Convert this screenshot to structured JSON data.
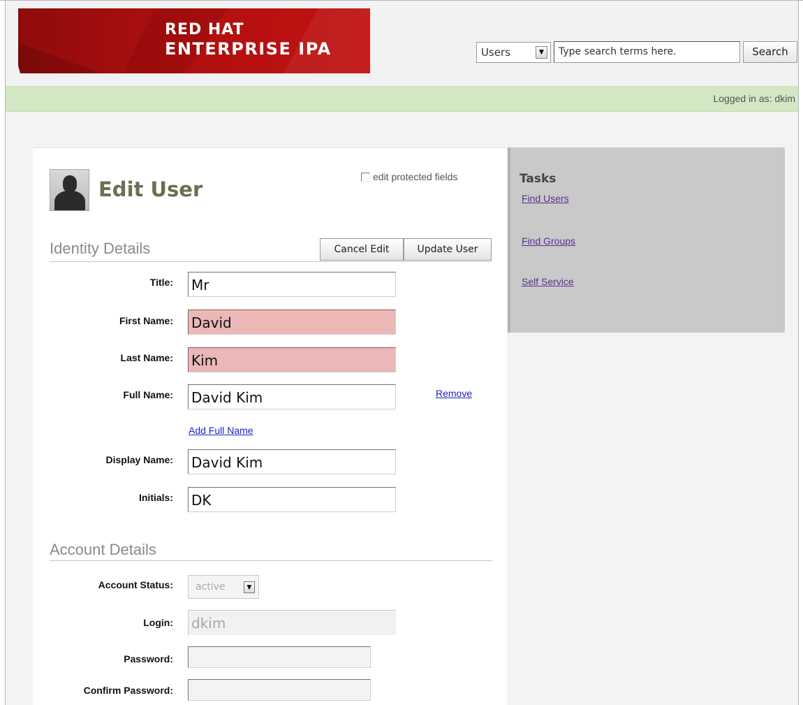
{
  "header": {
    "logo_line1": "RED HAT",
    "logo_line2": "ENTERPRISE IPA",
    "search_scope": "Users",
    "search_placeholder": "Type search terms here.",
    "search_button": "Search"
  },
  "userbar": {
    "logged_in": "Logged in as: dkim"
  },
  "page": {
    "title": "Edit User",
    "edit_protected": "edit protected fields",
    "edit_protected_checked": false
  },
  "identity": {
    "heading": "Identity Details",
    "cancel_button": "Cancel Edit",
    "update_button": "Update User",
    "title_label": "Title:",
    "title_value": "Mr",
    "first_label": "First Name:",
    "first_value": "David",
    "last_label": "Last Name:",
    "last_value": "Kim",
    "full_label": "Full Name:",
    "full_value": "David Kim",
    "remove_link": "Remove",
    "add_full_link": "Add Full Name",
    "display_label": "Display Name:",
    "display_value": "David Kim",
    "initials_label": "Initials:",
    "initials_value": "DK"
  },
  "account": {
    "heading": "Account Details",
    "status_label": "Account Status:",
    "status_value": "active",
    "login_label": "Login:",
    "login_value": "dkim",
    "password_label": "Password:",
    "password_value": "",
    "confirm_label": "Confirm Password:",
    "confirm_value": ""
  },
  "tasks": {
    "title": "Tasks",
    "items": [
      {
        "label": "Find Users"
      },
      {
        "label": "Find Groups"
      },
      {
        "label": "Self Service"
      }
    ]
  },
  "colors": {
    "banner_red": "#b51010",
    "userbar_green": "#d2e8c4",
    "required_field": "#ebb7b7",
    "title_olive": "#69704f",
    "task_link": "#5a2f8e"
  }
}
